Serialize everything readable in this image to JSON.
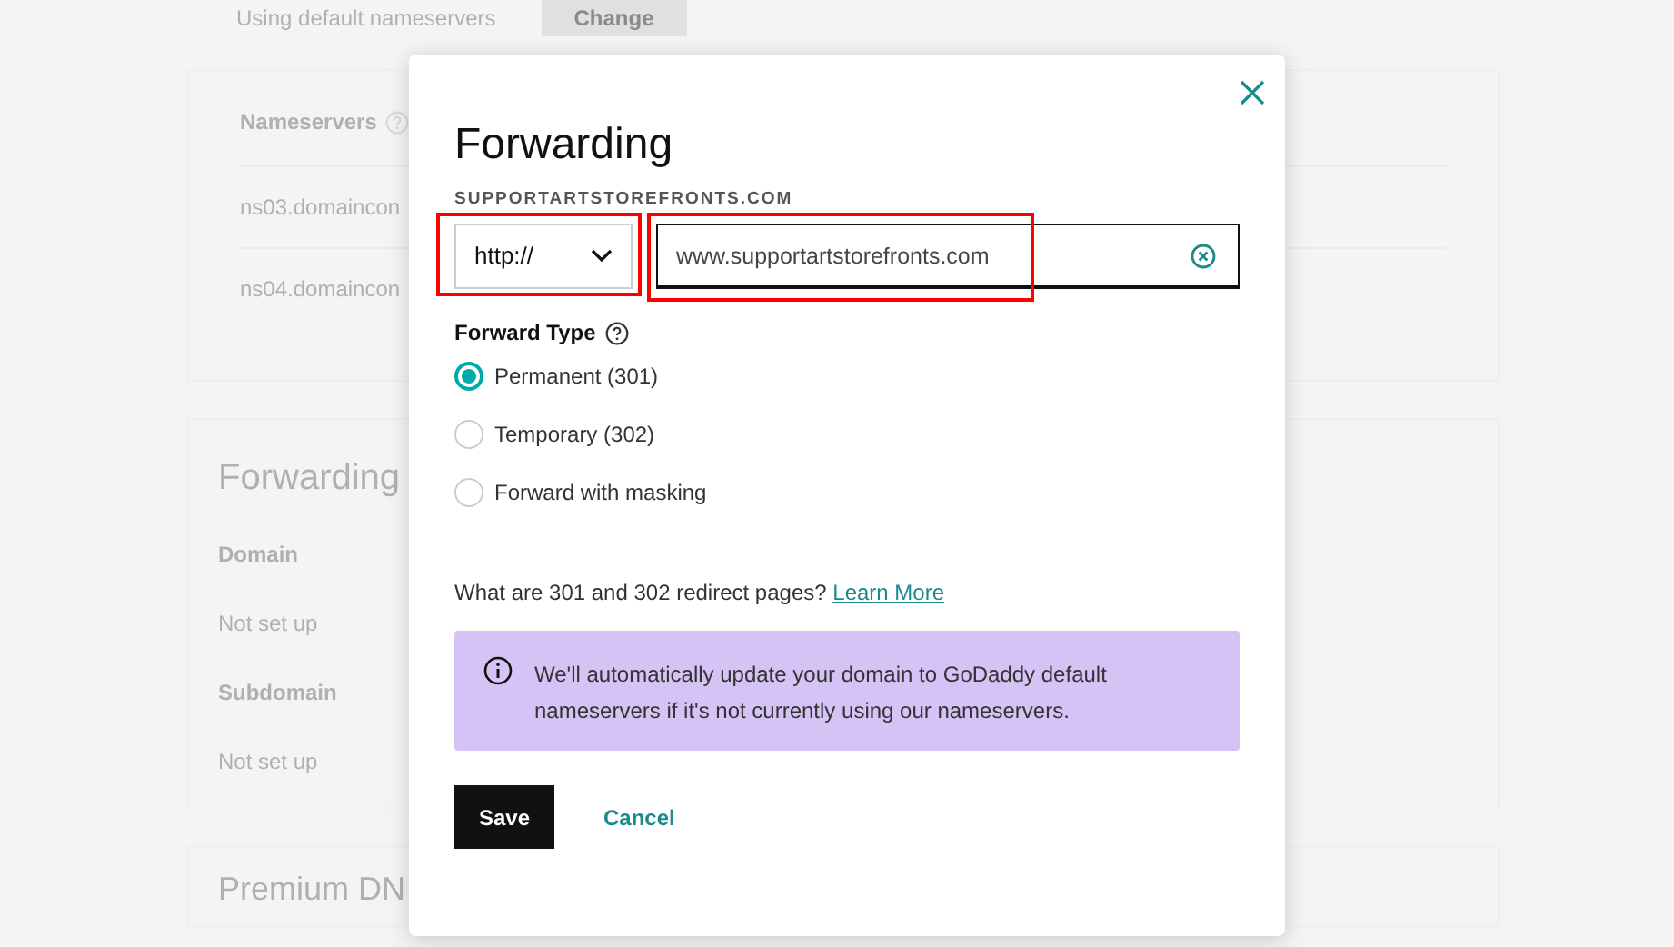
{
  "background": {
    "top_text": "Using default nameservers",
    "change_button": "Change",
    "nameservers_heading": "Nameservers",
    "nameservers": [
      "ns03.domaincon",
      "ns04.domaincon"
    ],
    "forwarding_heading": "Forwarding",
    "rows": [
      {
        "label": "Domain",
        "value": "Not set up"
      },
      {
        "label": "Subdomain",
        "value": "Not set up"
      }
    ],
    "premium_heading": "Premium DN"
  },
  "dialog": {
    "title": "Forwarding",
    "domain_label": "SUPPORTARTSTOREFRONTS.COM",
    "protocol": {
      "value": "http://",
      "highlighted": true
    },
    "url": {
      "value": "www.supportartstorefronts.com",
      "highlighted": true
    },
    "forward_type_label": "Forward Type",
    "options": [
      {
        "label": "Permanent (301)",
        "selected": true
      },
      {
        "label": "Temporary (302)",
        "selected": false
      },
      {
        "label": "Forward with masking",
        "selected": false
      }
    ],
    "help_text": "What are 301 and 302 redirect pages?",
    "help_link": "Learn More",
    "notice": "We'll automatically update your domain to GoDaddy default nameservers if it's not currently using our nameservers.",
    "buttons": {
      "save": "Save",
      "cancel": "Cancel"
    }
  }
}
